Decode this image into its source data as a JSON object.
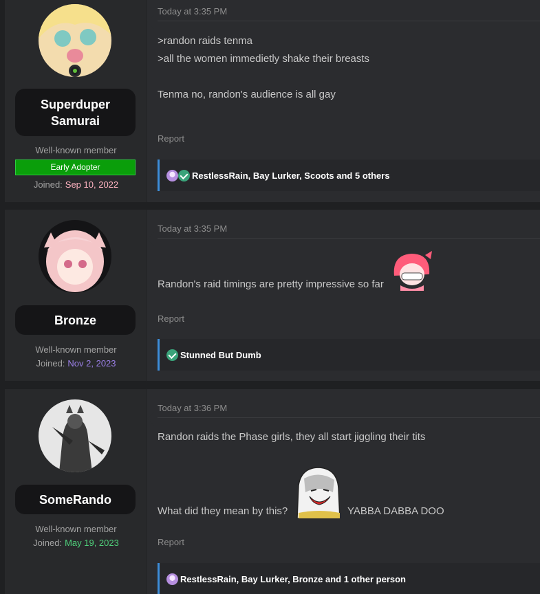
{
  "posts": [
    {
      "username": "Superduper Samurai",
      "user_title": "Well-known member",
      "badge": "Early Adopter",
      "joined_label": "Joined:",
      "joined_date": "Sep 10, 2022",
      "joined_color": "#ffb3c1",
      "timestamp": "Today at 3:35 PM",
      "lines": [
        ">randon raids tenma",
        ">all the women immedietly shake their breasts",
        "Tenma no, randon's audience is all gay"
      ],
      "report": "Report",
      "reactions": "RestlessRain, Bay Lurker, Scoots and 5 others",
      "reaction_icons": [
        "purple-anime-reaction-icon",
        "check-reaction-icon"
      ]
    },
    {
      "username": "Bronze",
      "user_title": "Well-known member",
      "joined_label": "Joined:",
      "joined_date": "Nov 2, 2023",
      "joined_color": "#9b7fe6",
      "timestamp": "Today at 3:35 PM",
      "lines": [
        "Randon's raid timings are pretty impressive so far"
      ],
      "report": "Report",
      "reactions": "Stunned But Dumb",
      "reaction_icons": [
        "check-reaction-icon"
      ]
    },
    {
      "username": "SomeRando",
      "user_title": "Well-known member",
      "joined_label": "Joined:",
      "joined_date": "May 19, 2023",
      "joined_color": "#4fcf7a",
      "timestamp": "Today at 3:36 PM",
      "lines": [
        "Randon raids the Phase girls, they all start jiggling their tits",
        "What did they mean by this?",
        "YABBA DABBA DOO"
      ],
      "report": "Report",
      "reactions": "RestlessRain, Bay Lurker, Bronze and 1 other person",
      "reaction_icons": [
        "purple-anime-reaction-icon"
      ]
    }
  ],
  "colors": {
    "background": "#1f2022",
    "post_bg": "#2b2c2f",
    "badge_green": "#0a9e0a",
    "reaction_border": "#3d8dd8",
    "online_dot": "#5fbf3a"
  }
}
